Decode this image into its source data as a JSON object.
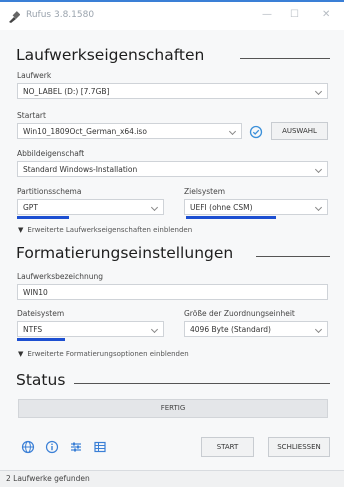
{
  "window": {
    "title": "Rufus 3.8.1580",
    "controls": {
      "minimize": "—",
      "maximize": "☐",
      "close": "✕"
    }
  },
  "drive_properties": {
    "heading": "Laufwerkseigenschaften",
    "device_label": "Laufwerk",
    "device_value": "NO_LABEL (D:) [7.7GB]",
    "boot_label": "Startart",
    "boot_value": "Win10_1809Oct_German_x64.iso",
    "select_button": "AUSWAHL",
    "image_option_label": "Abbildeigenschaft",
    "image_option_value": "Standard Windows-Installation",
    "partition_label": "Partitionsschema",
    "partition_value": "GPT",
    "target_label": "Zielsystem",
    "target_value": "UEFI (ohne CSM)",
    "advanced_toggle": "Erweiterte Laufwerkseigenschaften einblenden"
  },
  "format_options": {
    "heading": "Formatierungseinstellungen",
    "volume_label": "Laufwerksbezeichnung",
    "volume_value": "WIN10",
    "filesystem_label": "Dateisystem",
    "filesystem_value": "NTFS",
    "cluster_label": "Größe der Zuordnungseinheit",
    "cluster_value": "4096 Byte (Standard)",
    "advanced_toggle": "Erweiterte Formatierungsoptionen einblenden"
  },
  "status": {
    "heading": "Status",
    "progress_text": "FERTIG",
    "progress": 1.0
  },
  "actions": {
    "start": "START",
    "close": "SCHLIESSEN",
    "icons": [
      "globe-icon",
      "info-icon",
      "settings-icon",
      "log-icon"
    ]
  },
  "statusbar": {
    "text": "2 Laufwerke gefunden"
  },
  "colors": {
    "accent": "#1d4fd1",
    "check": "#3a8fd9",
    "icon": "#3a7fd6"
  }
}
